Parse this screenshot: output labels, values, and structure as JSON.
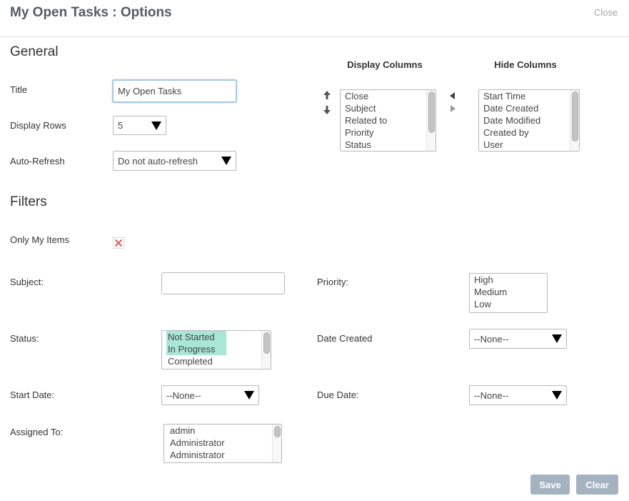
{
  "dialog": {
    "title": "My Open Tasks : Options",
    "close_label": "Close"
  },
  "general": {
    "heading": "General",
    "title_label": "Title",
    "title_value": "My Open Tasks",
    "display_rows_label": "Display Rows",
    "display_rows_value": "5",
    "auto_refresh_label": "Auto-Refresh",
    "auto_refresh_value": "Do not auto-refresh"
  },
  "columns": {
    "display_heading": "Display Columns",
    "hide_heading": "Hide Columns",
    "display": [
      "Close",
      "Subject",
      "Related to",
      "Priority",
      "Status"
    ],
    "hide": [
      "Start Time",
      "Date Created",
      "Date Modified",
      "Created by",
      "User"
    ]
  },
  "filters": {
    "heading": "Filters",
    "only_my_items_label": "Only My Items",
    "only_my_items_checked": true,
    "subject_label": "Subject:",
    "subject_value": "",
    "priority_label": "Priority:",
    "priority_options": [
      "High",
      "Medium",
      "Low"
    ],
    "status_label": "Status:",
    "status_options": [
      "Not Started",
      "In Progress",
      "Completed"
    ],
    "status_selected": [
      true,
      true,
      false
    ],
    "date_created_label": "Date Created",
    "date_created_value": "--None--",
    "start_date_label": "Start Date:",
    "start_date_value": "--None--",
    "due_date_label": "Due Date:",
    "due_date_value": "--None--",
    "assigned_to_label": "Assigned To:",
    "assigned_to_options": [
      "admin",
      "Administrator",
      "Administrator"
    ]
  },
  "actions": {
    "save_label": "Save",
    "clear_label": "Clear"
  },
  "colors": {
    "accent_focus": "#a7c7e7",
    "selected_option": "#a9e6d6",
    "button": "#a5b3c1",
    "checkbox_mark": "#e0605a"
  }
}
